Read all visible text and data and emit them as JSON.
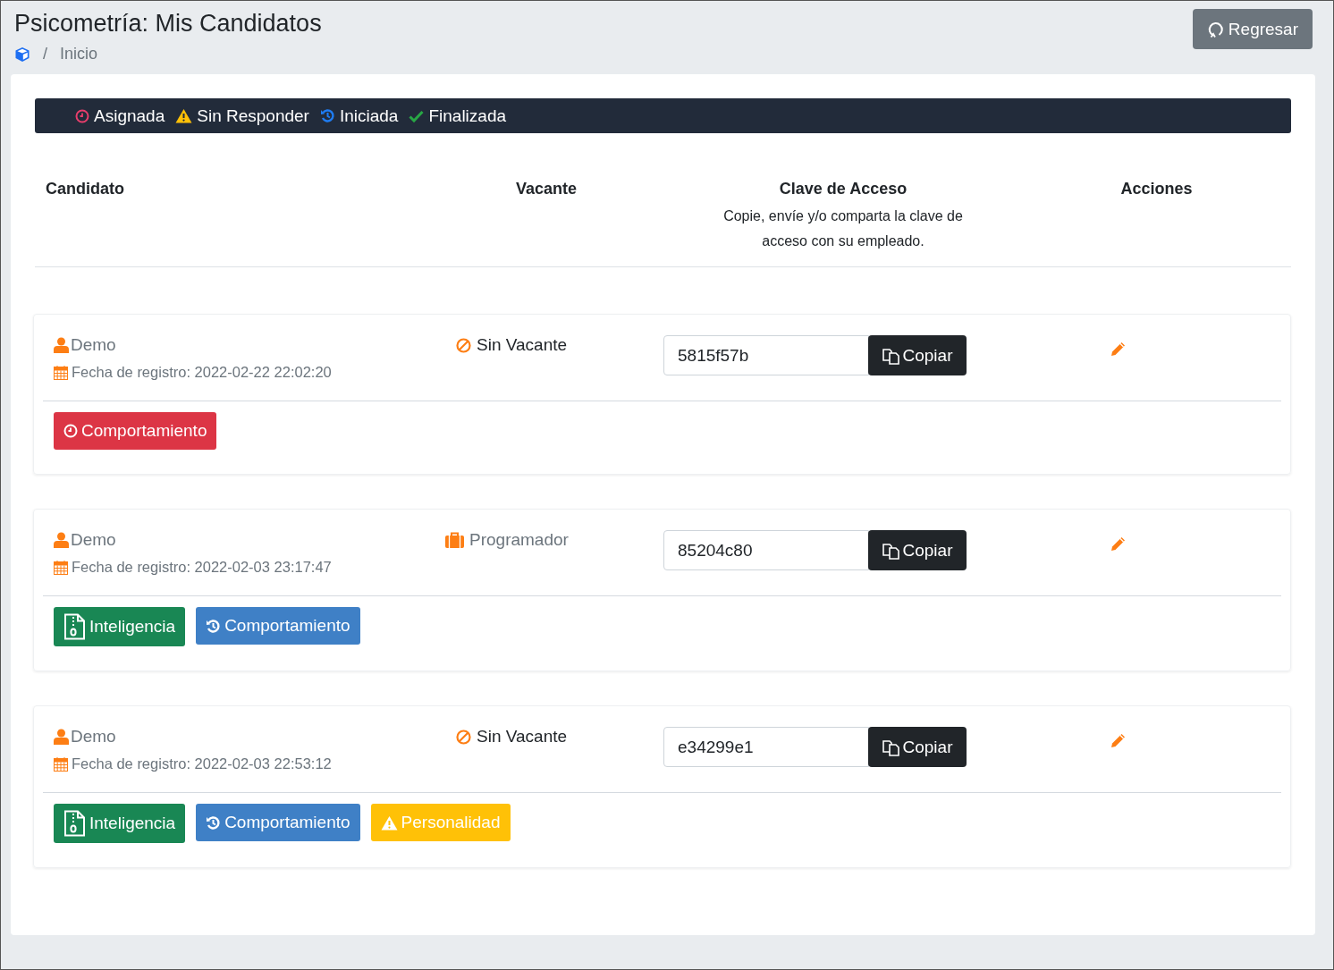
{
  "page": {
    "title": "Psicometría: Mis Candidatos",
    "back_button": "Regresar",
    "breadcrumb_separator": "/",
    "breadcrumb": [
      "Inicio"
    ]
  },
  "legend": [
    {
      "kind": "assigned",
      "label": "Asignada"
    },
    {
      "kind": "unanswered",
      "label": "Sin Responder"
    },
    {
      "kind": "started",
      "label": "Iniciada"
    },
    {
      "kind": "finished",
      "label": "Finalizada"
    }
  ],
  "table": {
    "columns": [
      {
        "label": "Candidato"
      },
      {
        "label": "Vacante"
      },
      {
        "label": "Clave de Acceso",
        "note": "Copie, envíe y/o comparta la clave de acceso con su empleado."
      },
      {
        "label": "Acciones"
      }
    ],
    "rows": [
      {
        "name": "Demo",
        "registered": "Fecha de registro: 2022-02-22 22:02:20",
        "vacancy": {
          "kind": "none",
          "label": "Sin Vacante"
        },
        "access_key": "5815f57b",
        "copy_button": "Copiar",
        "tests": [
          {
            "kind": "assigned",
            "label": "Comportamiento"
          }
        ]
      },
      {
        "name": "Demo",
        "registered": "Fecha de registro: 2022-02-03 23:17:47",
        "vacancy": {
          "kind": "job",
          "label": "Programador"
        },
        "access_key": "85204c80",
        "copy_button": "Copiar",
        "tests": [
          {
            "kind": "finished",
            "label": "Inteligencia"
          },
          {
            "kind": "started",
            "label": "Comportamiento"
          }
        ]
      },
      {
        "name": "Demo",
        "registered": "Fecha de registro: 2022-02-03 22:53:12",
        "vacancy": {
          "kind": "none",
          "label": "Sin Vacante"
        },
        "access_key": "e34299e1",
        "copy_button": "Copiar",
        "tests": [
          {
            "kind": "finished",
            "label": "Inteligencia"
          },
          {
            "kind": "started",
            "label": "Comportamiento"
          },
          {
            "kind": "unanswered",
            "label": "Personalidad"
          }
        ]
      }
    ]
  }
}
